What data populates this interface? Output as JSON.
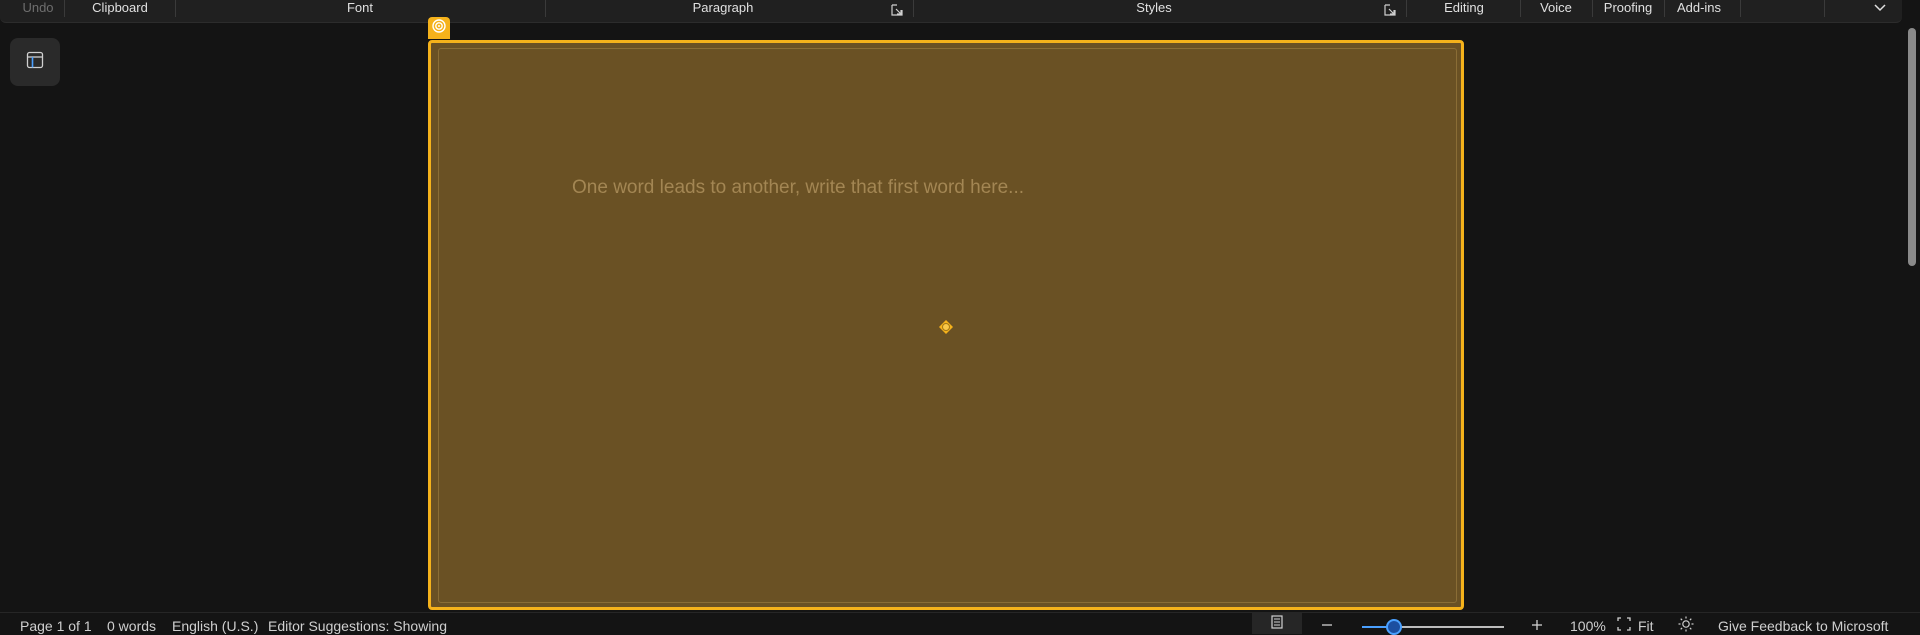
{
  "ribbon": {
    "groups": {
      "undo": "Undo",
      "clipboard": "Clipboard",
      "font": "Font",
      "paragraph": "Paragraph",
      "styles": "Styles",
      "editing": "Editing",
      "voice": "Voice",
      "proofing": "Proofing",
      "addins": "Add-ins"
    }
  },
  "document": {
    "placeholder": "One word leads to another, write that first word here..."
  },
  "status": {
    "page": "Page 1 of 1",
    "words": "0 words",
    "language": "English (U.S.)",
    "editor": "Editor Suggestions: Showing",
    "zoom_percent": "100%",
    "fit_label": "Fit",
    "feedback": "Give Feedback to Microsoft"
  },
  "zoom": {
    "value": 100
  },
  "colors": {
    "accent": "#f5b21b",
    "content_fill": "#6a5124",
    "background": "#141414",
    "slider": "#4aa0ff"
  },
  "icons": [
    "dialog-launcher-icon",
    "chevron-down-icon",
    "navigation-pane-icon",
    "loop-component-icon",
    "move-handle-icon",
    "focus-mode-icon",
    "minus-icon",
    "plus-icon",
    "fit-icon",
    "brightness-icon"
  ]
}
